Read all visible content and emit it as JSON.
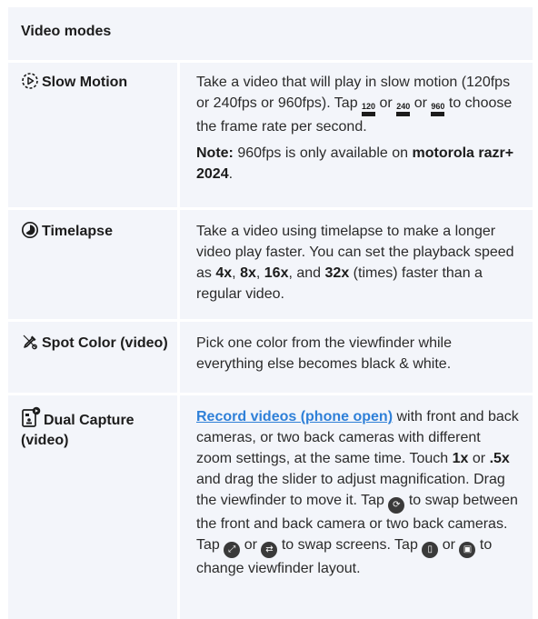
{
  "header": {
    "title": "Video modes"
  },
  "rows": [
    {
      "title": "Slow Motion",
      "icon": "slow-motion-icon",
      "desc_part1": "Take a video that will play in slow motion (120fps or 240fps or 960fps). Tap",
      "fps1": "120",
      "or1": "or",
      "fps2": "240",
      "or2": "or",
      "fps3": "960",
      "desc_part2": "to choose the frame rate per second.",
      "note_label": "Note:",
      "note_text": "960fps is only available on",
      "note_bold": "motorola razr+ 2024",
      "note_end": "."
    },
    {
      "title": "Timelapse",
      "icon": "timelapse-icon",
      "desc_part1": "Take a video using timelapse to make a longer video play faster. You can set the playback speed as",
      "b1": "4x",
      "sep1": ",",
      "b2": "8x",
      "sep2": ",",
      "b3": "16x",
      "sep3": ", and",
      "b4": "32x",
      "desc_part2": "(times) faster than a regular video."
    },
    {
      "title": "Spot Color (video)",
      "icon": "eyedropper-icon",
      "desc": "Pick one color from the viewfinder while everything else becomes black & white."
    },
    {
      "title": "Dual Capture (video)",
      "icon": "dual-capture-icon",
      "link": "Record videos (phone open)",
      "t1": "with front and back cameras, or two back cameras with different zoom settings, at the same time. Touch",
      "z1": "1x",
      "t2": "or",
      "z2": ".5x",
      "t3": "and drag the slider to adjust magnification. Drag the viewfinder to move it. Tap",
      "t4": "to swap between the front and back camera or two back cameras. Tap",
      "t5": "or",
      "t6": "to swap screens. Tap",
      "t7": "or",
      "t8": "to change viewfinder layout."
    }
  ]
}
